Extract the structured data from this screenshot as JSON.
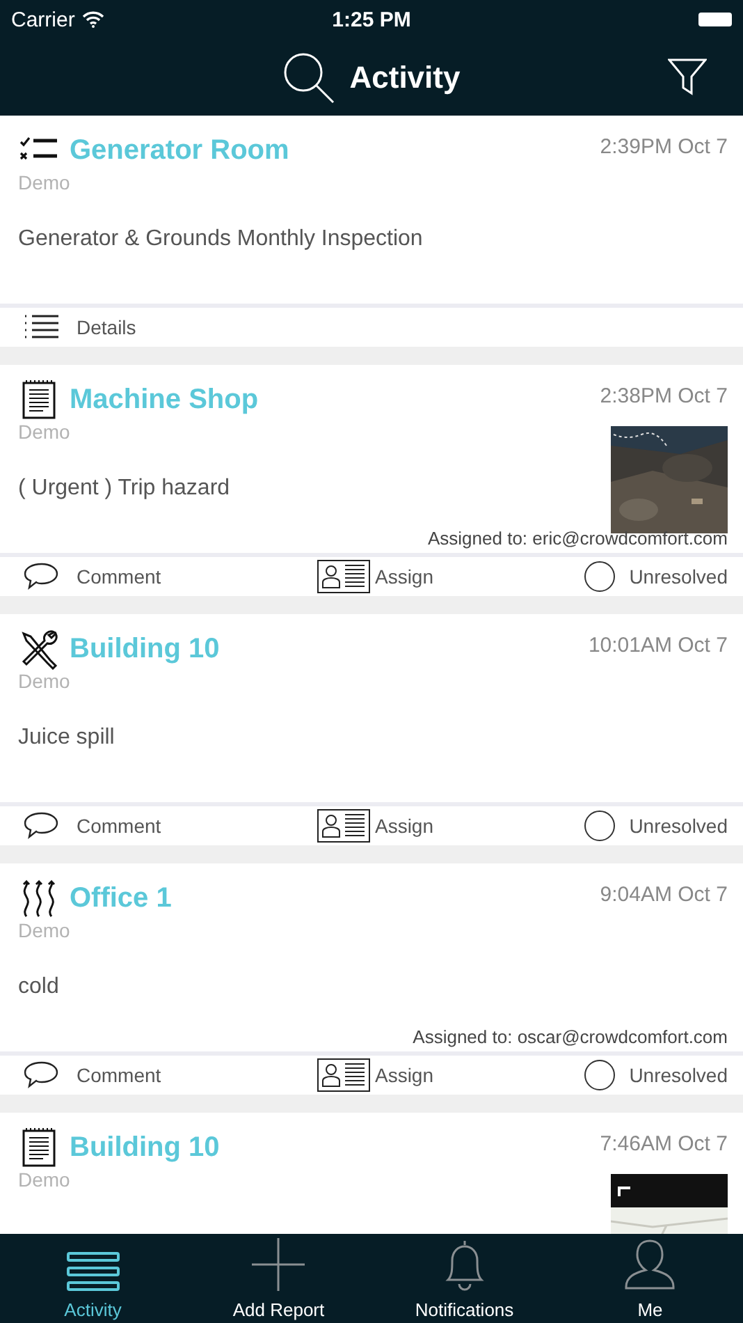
{
  "status_bar": {
    "carrier": "Carrier",
    "time": "1:25 PM"
  },
  "nav": {
    "title": "Activity"
  },
  "cards": [
    {
      "kind": "checklist",
      "title": "Generator Room",
      "time": "2:39PM Oct 7",
      "site": "Demo",
      "description": "Generator & Grounds Monthly Inspection",
      "actions": [
        {
          "kind": "details",
          "label": "Details"
        }
      ]
    },
    {
      "kind": "notepad",
      "title": "Machine Shop",
      "time": "2:38PM Oct 7",
      "site": "Demo",
      "description": "( Urgent ) Trip hazard",
      "attachment": {
        "kind": "picture"
      },
      "assigned": "Assigned to: eric@crowdcomfort.com",
      "actions": [
        {
          "kind": "comment",
          "label": "Comment"
        },
        {
          "kind": "assign",
          "label": "Assign"
        },
        {
          "kind": "status",
          "label": "Unresolved",
          "resolved": false
        }
      ]
    },
    {
      "kind": "tools",
      "title": "Building 10",
      "time": "10:01AM Oct 7",
      "site": "Demo",
      "description": "Juice spill",
      "actions": [
        {
          "kind": "comment",
          "label": "Comment"
        },
        {
          "kind": "assign",
          "label": "Assign"
        },
        {
          "kind": "status",
          "label": "Unresolved",
          "resolved": false
        }
      ]
    },
    {
      "kind": "heat",
      "title": "Office 1",
      "time": "9:04AM Oct 7",
      "site": "Demo",
      "description": "cold",
      "assigned": "Assigned to: oscar@crowdcomfort.com",
      "actions": [
        {
          "kind": "comment",
          "label": "Comment"
        },
        {
          "kind": "assign",
          "label": "Assign"
        },
        {
          "kind": "status",
          "label": "Unresolved",
          "resolved": false
        }
      ]
    },
    {
      "kind": "notepad",
      "title": "Building 10",
      "time": "7:46AM Oct 7",
      "site": "Demo",
      "attachment": {
        "kind": "picture"
      }
    }
  ],
  "tab_bar": [
    {
      "kind": "list",
      "label": "Activity",
      "selected": true
    },
    {
      "kind": "plus",
      "label": "Add Report",
      "selected": false
    },
    {
      "kind": "bell",
      "label": "Notifications",
      "selected": false
    },
    {
      "kind": "person",
      "label": "Me",
      "selected": false
    }
  ]
}
